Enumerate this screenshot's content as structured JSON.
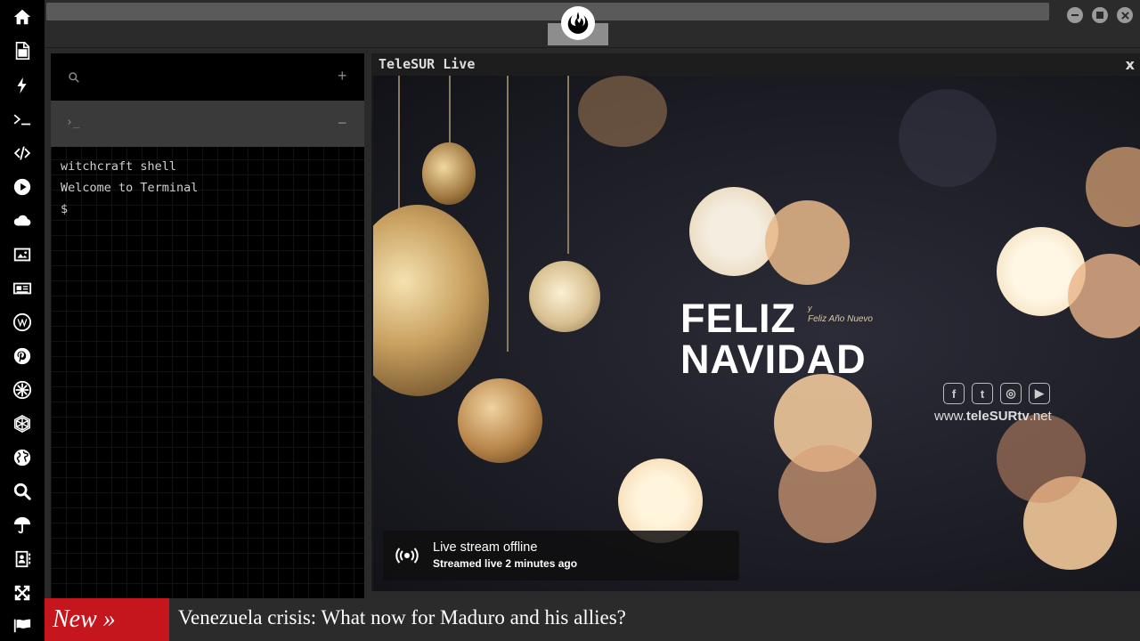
{
  "sidebar": {
    "icons": [
      "home-icon",
      "document-icon",
      "lightning-icon",
      "terminal-icon",
      "code-icon",
      "play-icon",
      "cloud-icon",
      "image-icon",
      "news-icon",
      "wordpress-icon",
      "pinterest-icon",
      "rebel-settings-icon",
      "network-icon",
      "globe-icon",
      "search-icon",
      "umbrella-icon",
      "contacts-icon",
      "expand-icon",
      "flag-icon"
    ]
  },
  "terminal": {
    "lines": [
      "witchcraft shell",
      "Welcome to Terminal",
      "$"
    ],
    "tab_prompt": "›_",
    "add_symbol": "+",
    "minus_symbol": "−"
  },
  "video": {
    "title": "TeleSUR Live",
    "close": "x",
    "greeting_line1": "FELIZ",
    "greeting_line2": "NAVIDAD",
    "greeting_y": "y",
    "greeting_sub": "Feliz Año Nuevo",
    "site_prefix": "www.",
    "site_name": "teleSURtv",
    "site_suffix": ".net",
    "offline_title": "Live stream offline",
    "offline_sub": "Streamed live 2 minutes ago"
  },
  "ticker": {
    "label": "New »",
    "headline": "Venezuela crisis: What now for Maduro and his allies?"
  },
  "colors": {
    "accent_red": "#c4161c",
    "sidebar_bg": "#000000",
    "panel_bg": "#2b2b2b"
  }
}
